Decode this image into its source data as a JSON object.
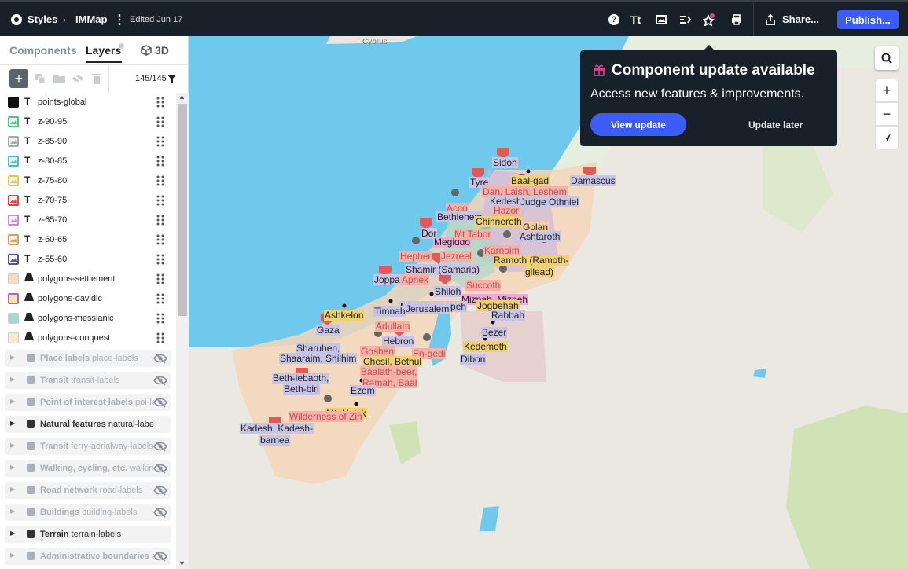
{
  "topbar": {
    "styles": "Styles",
    "map_name": "IMMap",
    "edited": "Edited Jun 17",
    "share": "Share...",
    "publish": "Publish..."
  },
  "sidebar": {
    "tabs": [
      "Components",
      "Layers",
      "3D"
    ],
    "count": "145/145",
    "layers": [
      {
        "name": "points-global",
        "color": "#111111",
        "type": "T"
      },
      {
        "name": "z-90-95",
        "color": "#4ec48c",
        "type": "T"
      },
      {
        "name": "z-85-90",
        "color": "#aaaaaa",
        "type": "T"
      },
      {
        "name": "z-80-85",
        "color": "#3bc7c0",
        "type": "T"
      },
      {
        "name": "z-75-80",
        "color": "#e8c64a",
        "type": "T"
      },
      {
        "name": "z-70-75",
        "color": "#e04646",
        "type": "T"
      },
      {
        "name": "z-65-70",
        "color": "#c98ad6",
        "type": "T"
      },
      {
        "name": "z-60-65",
        "color": "#e0a050",
        "type": "T"
      },
      {
        "name": "z-55-60",
        "color": "#555599",
        "type": "T"
      },
      {
        "name": "polygons-settlement",
        "color": "#f6dcc2",
        "type": "poly"
      },
      {
        "name": "polygons-davidic",
        "color": "#b066d8",
        "type": "poly"
      },
      {
        "name": "polygons-messianic",
        "color": "#a6d9c9",
        "type": "poly"
      },
      {
        "name": "polygons-conquest",
        "color": "#f3ebcf",
        "type": "poly"
      }
    ],
    "groups": [
      {
        "title": "Place labels",
        "id": "place-labels",
        "hidden": true
      },
      {
        "title": "Transit",
        "id": "transit-labels",
        "hidden": true
      },
      {
        "title": "Point of interest labels",
        "id": "poi-labels",
        "hidden": true
      },
      {
        "title": "Natural features",
        "id": "natural-labels",
        "hidden": false
      },
      {
        "title": "Transit",
        "id": "ferry-aerialway-labels",
        "hidden": true
      },
      {
        "title": "Walking, cycling, etc.",
        "id": "walking-cycling-labels",
        "hidden": true
      },
      {
        "title": "Road network",
        "id": "road-labels",
        "hidden": true
      },
      {
        "title": "Buildings",
        "id": "building-labels",
        "hidden": true
      },
      {
        "title": "Terrain",
        "id": "terrain-labels",
        "hidden": false
      },
      {
        "title": "Administrative boundaries",
        "id": "admin-labels",
        "hidden": true
      }
    ]
  },
  "popup": {
    "title": "Component update available",
    "body": "Access new features & improvements.",
    "primary": "View update",
    "secondary": "Update later"
  },
  "map": {
    "labels": [
      {
        "text": "Cyprus",
        "bg": "none",
        "color": "#777777"
      },
      {
        "text": "Sidon",
        "bg": "#c8c4e8"
      },
      {
        "text": "Tyre",
        "bg": "#c8c4e8"
      },
      {
        "text": "Baal-gad",
        "bg": "#f0d070"
      },
      {
        "text": "Damascus",
        "bg": "#c8c4e8"
      },
      {
        "text": "Dan, Laish, Leshem",
        "bg": "#f5b0a8",
        "color": "#c05050"
      },
      {
        "text": "Kedesh",
        "bg": "#c8c4e8"
      },
      {
        "text": "Judge Othniel",
        "bg": "#c8c4e8"
      },
      {
        "text": "Hazor",
        "bg": "#f5b0a8",
        "color": "#c05050"
      },
      {
        "text": "Acco",
        "bg": "#f5b0a8",
        "color": "#c05050"
      },
      {
        "text": "Bethlehem",
        "bg": "#c8c4e8"
      },
      {
        "text": "Chinnereth",
        "bg": "#f0d070"
      },
      {
        "text": "Golan",
        "bg": "#f5cfa0"
      },
      {
        "text": "Ashtaroth",
        "bg": "#c8c4e8"
      },
      {
        "text": "Dor",
        "bg": "#c8c4e8"
      },
      {
        "text": "Megiddo",
        "bg": "#f0a8d8"
      },
      {
        "text": "Mt Tabor",
        "bg": "#f5b0a8",
        "color": "#c05050"
      },
      {
        "text": "Hepher",
        "bg": "#f5b0a8",
        "color": "#c05050"
      },
      {
        "text": "Jezreel",
        "bg": "#f5b0a8",
        "color": "#c05050"
      },
      {
        "text": "Karnaim",
        "bg": "#f5b0a8",
        "color": "#c05050"
      },
      {
        "text": "Ramoth (Ramoth-",
        "bg": "#f0d070"
      },
      {
        "text": "gilead)",
        "bg": "#f0d070"
      },
      {
        "text": "Shamir (Samaria)",
        "bg": "#c8c4e8"
      },
      {
        "text": "Joppa",
        "bg": "#c8c4e8"
      },
      {
        "text": "Aphek",
        "bg": "#f5b0a8",
        "color": "#c05050"
      },
      {
        "text": "Shiloh",
        "bg": "#c8c4e8"
      },
      {
        "text": "Succoth",
        "bg": "#f5b0a8",
        "color": "#c05050"
      },
      {
        "text": "Mizpah, Mizpeh",
        "bg": "#f0a8d8"
      },
      {
        "text": "Jogbehah",
        "bg": "#f0d070"
      },
      {
        "text": "Mizpah, Mizpeh",
        "bg": "#c8c4e8"
      },
      {
        "text": "Jerusalem",
        "bg": "#c8c4e8"
      },
      {
        "text": "Timnah",
        "bg": "#c8c4e8"
      },
      {
        "text": "Rabbah",
        "bg": "#c8c4e8"
      },
      {
        "text": "Ashkelon",
        "bg": "#f0d070"
      },
      {
        "text": "Gaza",
        "bg": "#c8c4e8"
      },
      {
        "text": "Adullam",
        "bg": "#f5b0a8",
        "color": "#c05050"
      },
      {
        "text": "Hebron",
        "bg": "#c8c4e8"
      },
      {
        "text": "Bezer",
        "bg": "#c8c4e8"
      },
      {
        "text": "Sharuhen,",
        "bg": "#c8c4e8"
      },
      {
        "text": "Shaaraim, Shilhim",
        "bg": "#c8c4e8"
      },
      {
        "text": "Goshen",
        "bg": "#f5b0a8",
        "color": "#c05050"
      },
      {
        "text": "En-gedi",
        "bg": "#f5b0a8",
        "color": "#c05050"
      },
      {
        "text": "Kedemoth",
        "bg": "#f0d070"
      },
      {
        "text": "Chesil, Bethul",
        "bg": "#f0d070"
      },
      {
        "text": "Dibon",
        "bg": "#c8c4e8"
      },
      {
        "text": "Baalath-beer,",
        "bg": "#f5b0a8",
        "color": "#c05050"
      },
      {
        "text": "Ramah, Baal",
        "bg": "#f5b0a8",
        "color": "#c05050"
      },
      {
        "text": "Beth-lebaoth,",
        "bg": "#c8c4e8"
      },
      {
        "text": "Beth-biri",
        "bg": "#c8c4e8"
      },
      {
        "text": "Ezem",
        "bg": "#c8c4e8"
      },
      {
        "text": "Mt. Halak",
        "bg": "#f0d070"
      },
      {
        "text": "Wilderness of Zin",
        "bg": "#f5b0a8",
        "color": "#c05050"
      },
      {
        "text": "Kadesh, Kadesh-",
        "bg": "#c8c4e8"
      },
      {
        "text": "barnea",
        "bg": "#c8c4e8"
      }
    ]
  }
}
